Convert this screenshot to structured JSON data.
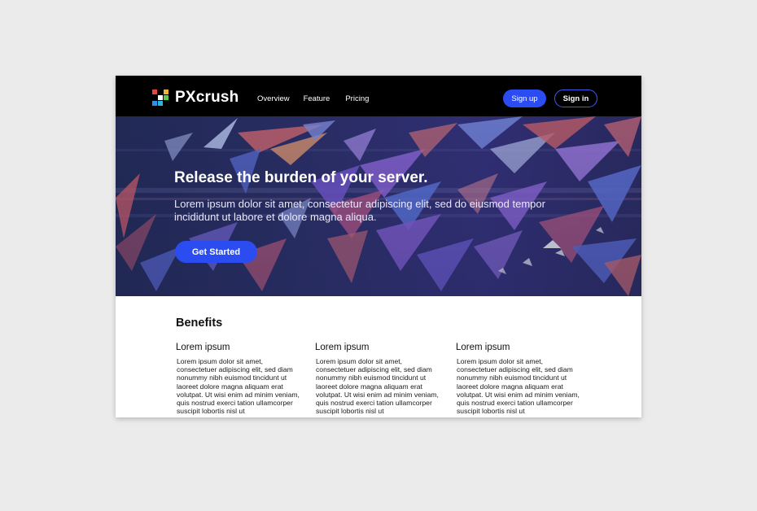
{
  "brand": {
    "name": "PXcrush"
  },
  "nav": {
    "links": [
      "Overview",
      "Feature",
      "Pricing"
    ],
    "signup_label": "Sign up",
    "signin_label": "Sign in"
  },
  "hero": {
    "title": "Release the burden of your server.",
    "text": "Lorem ipsum dolor sit amet, consectetur adipiscing elit, sed do eiusmod tempor incididunt ut labore et dolore magna aliqua.",
    "cta_label": "Get Started"
  },
  "benefits": {
    "title": "Benefits",
    "columns": [
      {
        "heading": "Lorem ipsum",
        "body": "Lorem ipsum dolor sit amet, consectetuer adipiscing elit, sed diam nonummy nibh euismod tincidunt ut laoreet dolore magna aliquam erat volutpat. Ut wisi enim ad minim veniam, quis nostrud exerci tation ullamcorper suscipit lobortis nisl ut"
      },
      {
        "heading": "Lorem ipsum",
        "body": "Lorem ipsum dolor sit amet, consectetuer adipiscing elit, sed diam nonummy nibh euismod tincidunt ut laoreet dolore magna aliquam erat volutpat. Ut wisi enim ad minim veniam, quis nostrud exerci tation ullamcorper suscipit lobortis nisl ut"
      },
      {
        "heading": "Lorem ipsum",
        "body": "Lorem ipsum dolor sit amet, consectetuer adipiscing elit, sed diam nonummy nibh euismod tincidunt ut laoreet dolore magna aliquam erat volutpat. Ut wisi enim ad minim veniam, quis nostrud exerci tation ullamcorper suscipit lobortis nisl ut"
      }
    ]
  },
  "colors": {
    "accent": "#2b4cf0",
    "nav_background": "#000000",
    "page_background": "#ebebeb"
  },
  "icons": [
    "pxcrush-logo-icon"
  ]
}
